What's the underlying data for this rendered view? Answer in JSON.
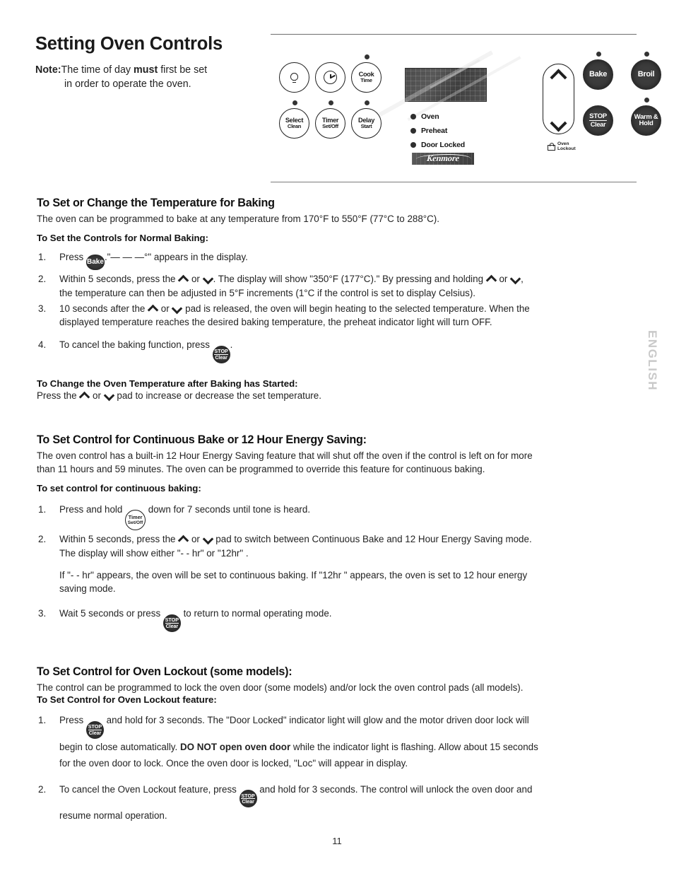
{
  "document": {
    "title": "Setting Oven Controls",
    "page_number": "11",
    "side_tab": "ENGLISH"
  },
  "note": {
    "label": "Note:",
    "line1_pre": "The time of day ",
    "line1_bold": "must",
    "line1_post": " first be set",
    "line2": "in order to operate the oven."
  },
  "control_panel": {
    "left_pads": [
      {
        "name": "oven-light-pad",
        "icon": "light-bulb-icon",
        "line1": "",
        "line2": "",
        "led": false
      },
      {
        "name": "clock-pad",
        "icon": "clock-icon",
        "line1": "",
        "line2": "",
        "led": false
      },
      {
        "name": "cook-time-pad",
        "icon": "",
        "line1": "Cook",
        "line2": "Time",
        "led": true
      },
      {
        "name": "select-clean-pad",
        "icon": "",
        "line1": "Select",
        "line2": "Clean",
        "led": true
      },
      {
        "name": "timer-set-off-pad",
        "icon": "",
        "line1": "Timer",
        "line2": "Set/Off",
        "led": true
      },
      {
        "name": "delay-start-pad",
        "icon": "",
        "line1": "Delay",
        "line2": "Start",
        "led": true
      }
    ],
    "right_pads": [
      {
        "name": "bake-pad",
        "line1": "Bake",
        "line2": "",
        "led": true
      },
      {
        "name": "broil-pad",
        "line1": "Broil",
        "line2": "",
        "led": true
      },
      {
        "name": "stop-clear-pad",
        "line1": "STOP",
        "line2": "Clear",
        "led": false
      },
      {
        "name": "warm-hold-pad",
        "line1": "Warm &",
        "line2": "Hold",
        "led": true
      }
    ],
    "indicators": [
      {
        "label": "Oven"
      },
      {
        "label": "Preheat"
      },
      {
        "label": "Door Locked"
      }
    ],
    "brand": "Kenmore",
    "lockout_icon_label_1": "Oven",
    "lockout_icon_label_2": "Lockout"
  },
  "sections": {
    "baking": {
      "heading": "To Set or Change the Temperature for Baking",
      "intro": "The oven can be programmed to bake at any temperature from 170°F to 550°F (77°C to 288°C).",
      "subheading": "To Set the Controls for Normal Baking:",
      "step1_num": "1.",
      "step1_pre": "Press ",
      "step1_badge": "Bake",
      "step1_post": ".\"— — —°\" appears in the display.",
      "step2_num": "2.",
      "step2_a": "Within 5 seconds, press the ",
      "step2_b": " or ",
      "step2_c": ".  The display will show \"350°F (177°C).\" By pressing and holding ",
      "step2_d": " or ",
      "step2_e": ",",
      "step2_line2": "the temperature can then be adjusted in 5°F increments (1°C if the control is set to display Celsius).",
      "step3_num": "3.",
      "step3_a": "10 seconds after the ",
      "step3_b": " or ",
      "step3_c": " pad is released, the oven will begin heating to the selected temperature. When the",
      "step3_line2": "displayed temperature reaches the desired baking temperature, the preheat indicator light will turn OFF.",
      "step4_num": "4.",
      "step4_pre": "To cancel the baking function, press ",
      "step4_post": ".",
      "after_subheading": "To Change the Oven Temperature after Baking has Started:",
      "after_a": "Press the ",
      "after_b": " or ",
      "after_c": " pad to increase or decrease the set temperature."
    },
    "continuous": {
      "heading": "To Set Control for Continuous Bake or 12 Hour Energy Saving:",
      "intro_line1": "The oven control has a built-in 12 Hour Energy Saving feature that will shut off the oven if the control is left on for more",
      "intro_line2": "than 11 hours and 59 minutes. The oven can be programmed to override this feature for continuous baking.",
      "subheading": "To set control for continuous baking:",
      "step1_num": "1.",
      "step1_pre": "Press and hold ",
      "step1_badge_l1": "Timer",
      "step1_badge_l2": "Set/Off",
      "step1_post": " down for 7 seconds until tone is heard.",
      "step2_num": "2.",
      "step2_a": "Within 5 seconds, press the ",
      "step2_b": " or ",
      "step2_c": " pad to switch between Continuous Bake and 12 Hour Energy Saving mode.",
      "step2_line2": "The display will show either \"- - hr\" or \"12hr\" .",
      "step2_para_line1": "If \"- - hr\" appears, the oven will be set to continuous baking. If \"12hr \" appears, the oven is set to 12 hour energy",
      "step2_para_line2": "saving mode.",
      "step3_num": "3.",
      "step3_pre": "Wait 5 seconds or press ",
      "step3_post": " to return to normal operating mode."
    },
    "lockout": {
      "heading": "To Set Control for Oven Lockout (some models):",
      "intro": "The control can be programmed to lock the oven door (some models) and/or lock the oven control pads (all models).",
      "subheading": "To Set Control for Oven Lockout feature:",
      "step1_num": "1.",
      "step1_pre": "Press ",
      "step1_mid": " and hold for 3 seconds. The \"Door Locked\" indicator light will glow and the motor driven door lock will",
      "step1_line2_a": "begin to close automatically. ",
      "step1_line2_bold": "DO NOT open oven door",
      "step1_line2_b": " while the indicator light is flashing. Allow about 15 seconds",
      "step1_line3": "for the oven door to lock. Once the oven door is locked, \"Loc\" will appear in display.",
      "step2_num": "2.",
      "step2_pre": "To cancel the Oven Lockout feature, press ",
      "step2_post": " and hold for 3 seconds. The control will unlock the oven door and",
      "step2_line2": "resume normal operation."
    }
  }
}
